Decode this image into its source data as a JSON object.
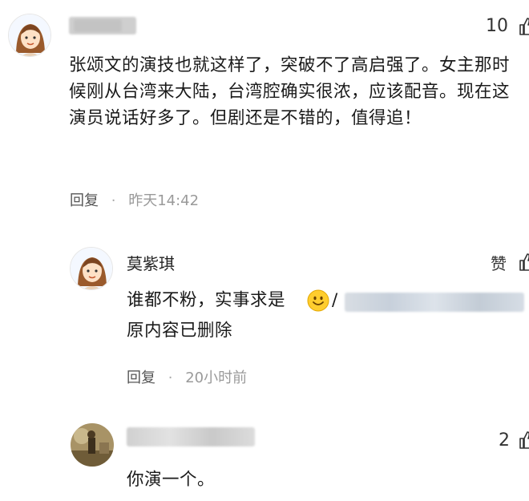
{
  "comment1": {
    "likes": "10",
    "text": "张颂文的演技也就这样了，突破不了高启强了。女主那时候刚从台湾来大陆，台湾腔确实很浓，应该配音。现在这演员说话好多了。但剧还是不错的，值得追！",
    "reply_label": "回复",
    "time": "昨天14:42"
  },
  "reply1": {
    "author": "莫紫琪",
    "like_label": "赞",
    "text_prefix": "谁都不粉，实事求是",
    "slash": "/",
    "deleted_text": "原内容已删除",
    "reply_label": "回复",
    "time": "20小时前"
  },
  "reply2": {
    "likes": "2",
    "text": "你演一个。"
  },
  "separator": "·",
  "icons": {
    "thumb": "thumbs-up-icon",
    "emoji": "smile-emoji-icon"
  }
}
